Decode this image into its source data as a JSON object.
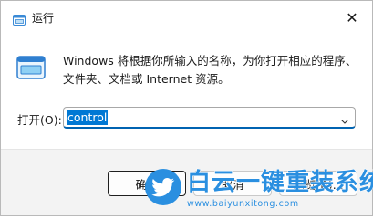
{
  "window": {
    "title": "运行",
    "close_glyph": "✕"
  },
  "description": {
    "line1": "Windows 将根据你所输入的名称，为你打开相应的程序、",
    "line2": "文件夹、文档或 Internet 资源。"
  },
  "open_field": {
    "label": "打开(O):",
    "value": "control"
  },
  "buttons": {
    "ok_label": "确定",
    "cancel_label": "取消",
    "browse_label": "浏览(B)..."
  },
  "watermark": {
    "title": "白云一键重装系统",
    "url": "www.baiyunxitong.com"
  },
  "colors": {
    "accent": "#0078d4",
    "footer_bg": "#f3f3f3",
    "watermark_blue": "#2a8fe0"
  },
  "icons": {
    "title": "run-icon",
    "app": "run-app-icon",
    "close": "close-icon",
    "dropdown": "chevron-down-icon",
    "watermark": "bird-logo-icon"
  }
}
